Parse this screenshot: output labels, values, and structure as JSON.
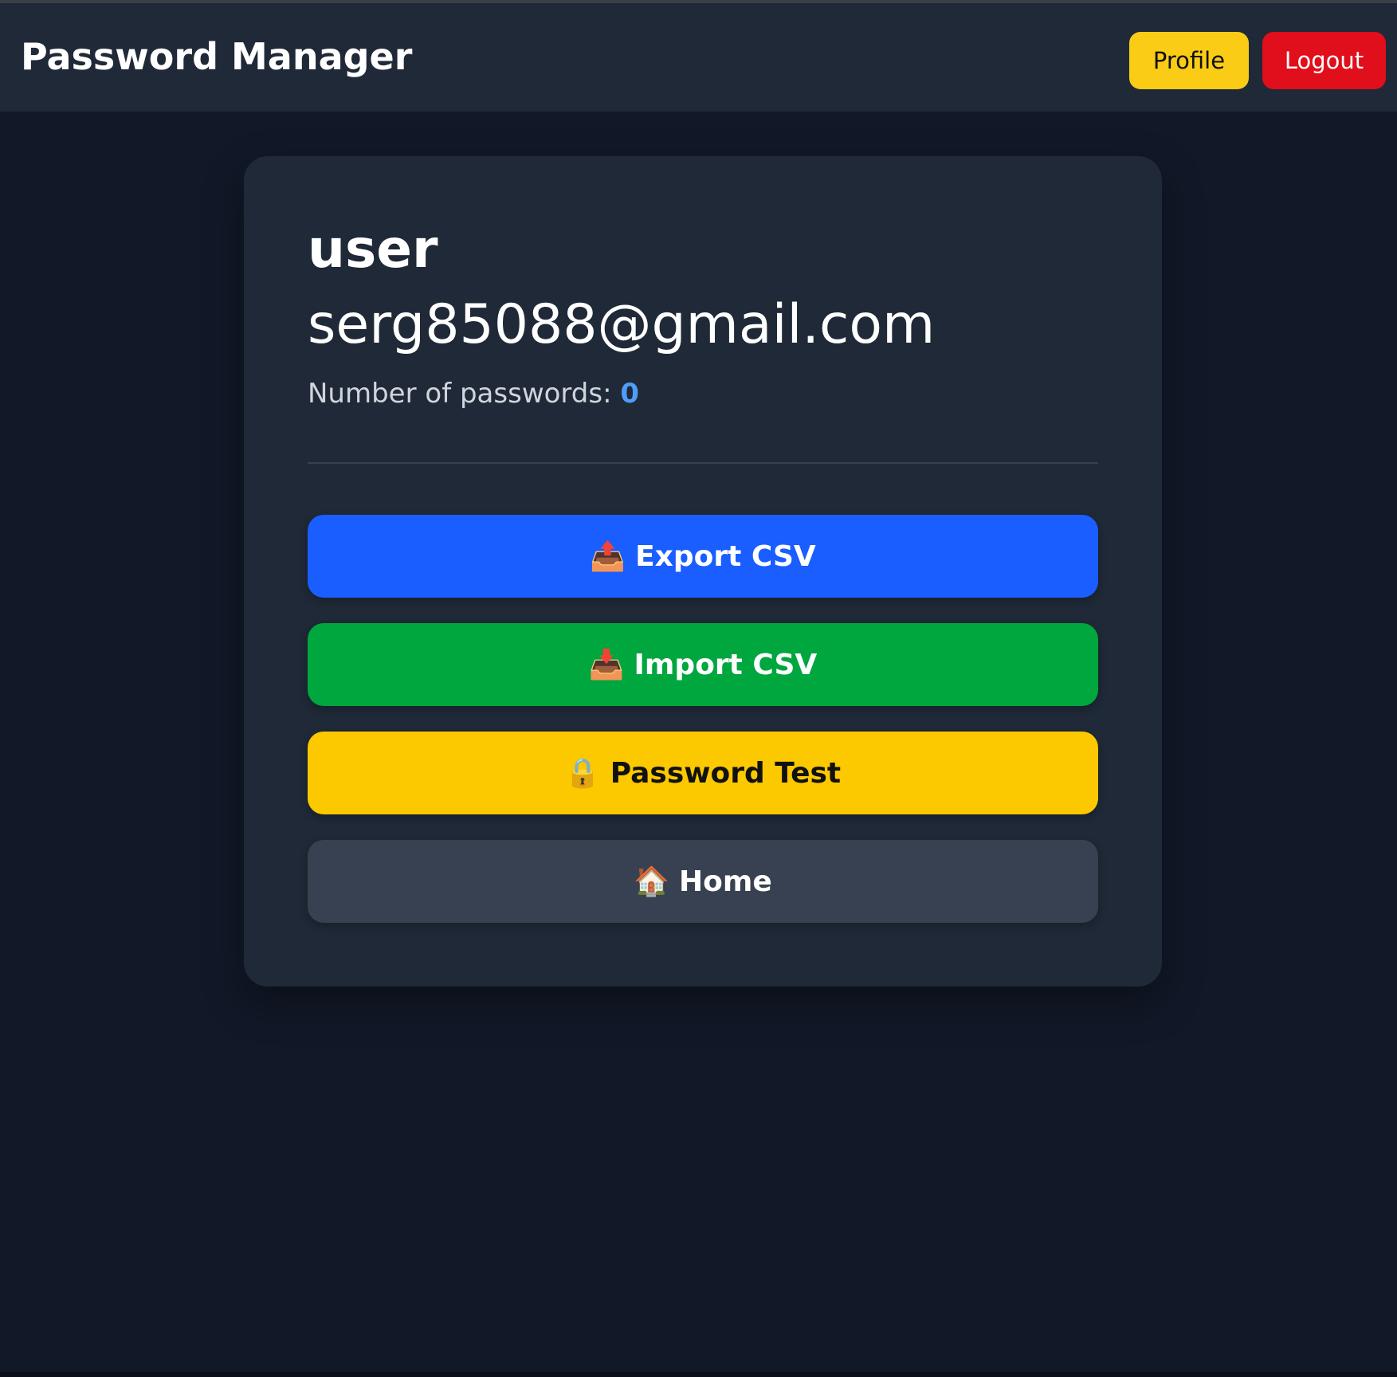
{
  "header": {
    "title": "Password Manager",
    "profile_label": "Profile",
    "logout_label": "Logout"
  },
  "profile": {
    "username": "user",
    "email": "serg85088@gmail.com",
    "count_label": "Number of passwords:",
    "count_value": "0"
  },
  "actions": {
    "export": {
      "icon": "📤",
      "icon_name": "outbox-tray-icon",
      "label": "Export CSV"
    },
    "import": {
      "icon": "📥",
      "icon_name": "inbox-tray-icon",
      "label": "Import CSV"
    },
    "test": {
      "icon": "🔒",
      "icon_name": "lock-icon",
      "label": "Password Test"
    },
    "home": {
      "icon": "🏠",
      "icon_name": "house-icon",
      "label": "Home"
    }
  },
  "colors": {
    "page_background": "#111827",
    "panel_background": "#1f2937",
    "profile_button": "#facc15",
    "logout_button": "#e10e1b",
    "export_button": "#1a5eff",
    "import_button": "#00a63e",
    "test_button": "#fcc800",
    "home_button": "#374151",
    "count_accent": "#4f9cf9"
  }
}
